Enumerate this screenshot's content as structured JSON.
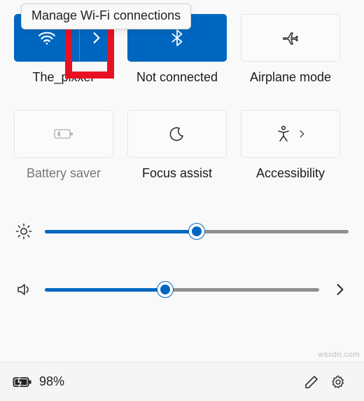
{
  "tooltip": {
    "text": "Manage Wi-Fi connections"
  },
  "tiles": {
    "wifi": {
      "label": "The_pixxer",
      "active": true
    },
    "bluetooth": {
      "label": "Not connected",
      "active": true
    },
    "airplane": {
      "label": "Airplane mode",
      "active": false
    },
    "battery": {
      "label": "Battery saver",
      "active": false,
      "disabled": true
    },
    "focus": {
      "label": "Focus assist",
      "active": false
    },
    "access": {
      "label": "Accessibility",
      "active": false
    }
  },
  "sliders": {
    "brightness": {
      "value": 50
    },
    "volume": {
      "value": 44
    }
  },
  "footer": {
    "battery_percent": "98%"
  },
  "watermark": "wsxdn.com",
  "colors": {
    "accent": "#0067c0",
    "highlight": "#e81123"
  }
}
